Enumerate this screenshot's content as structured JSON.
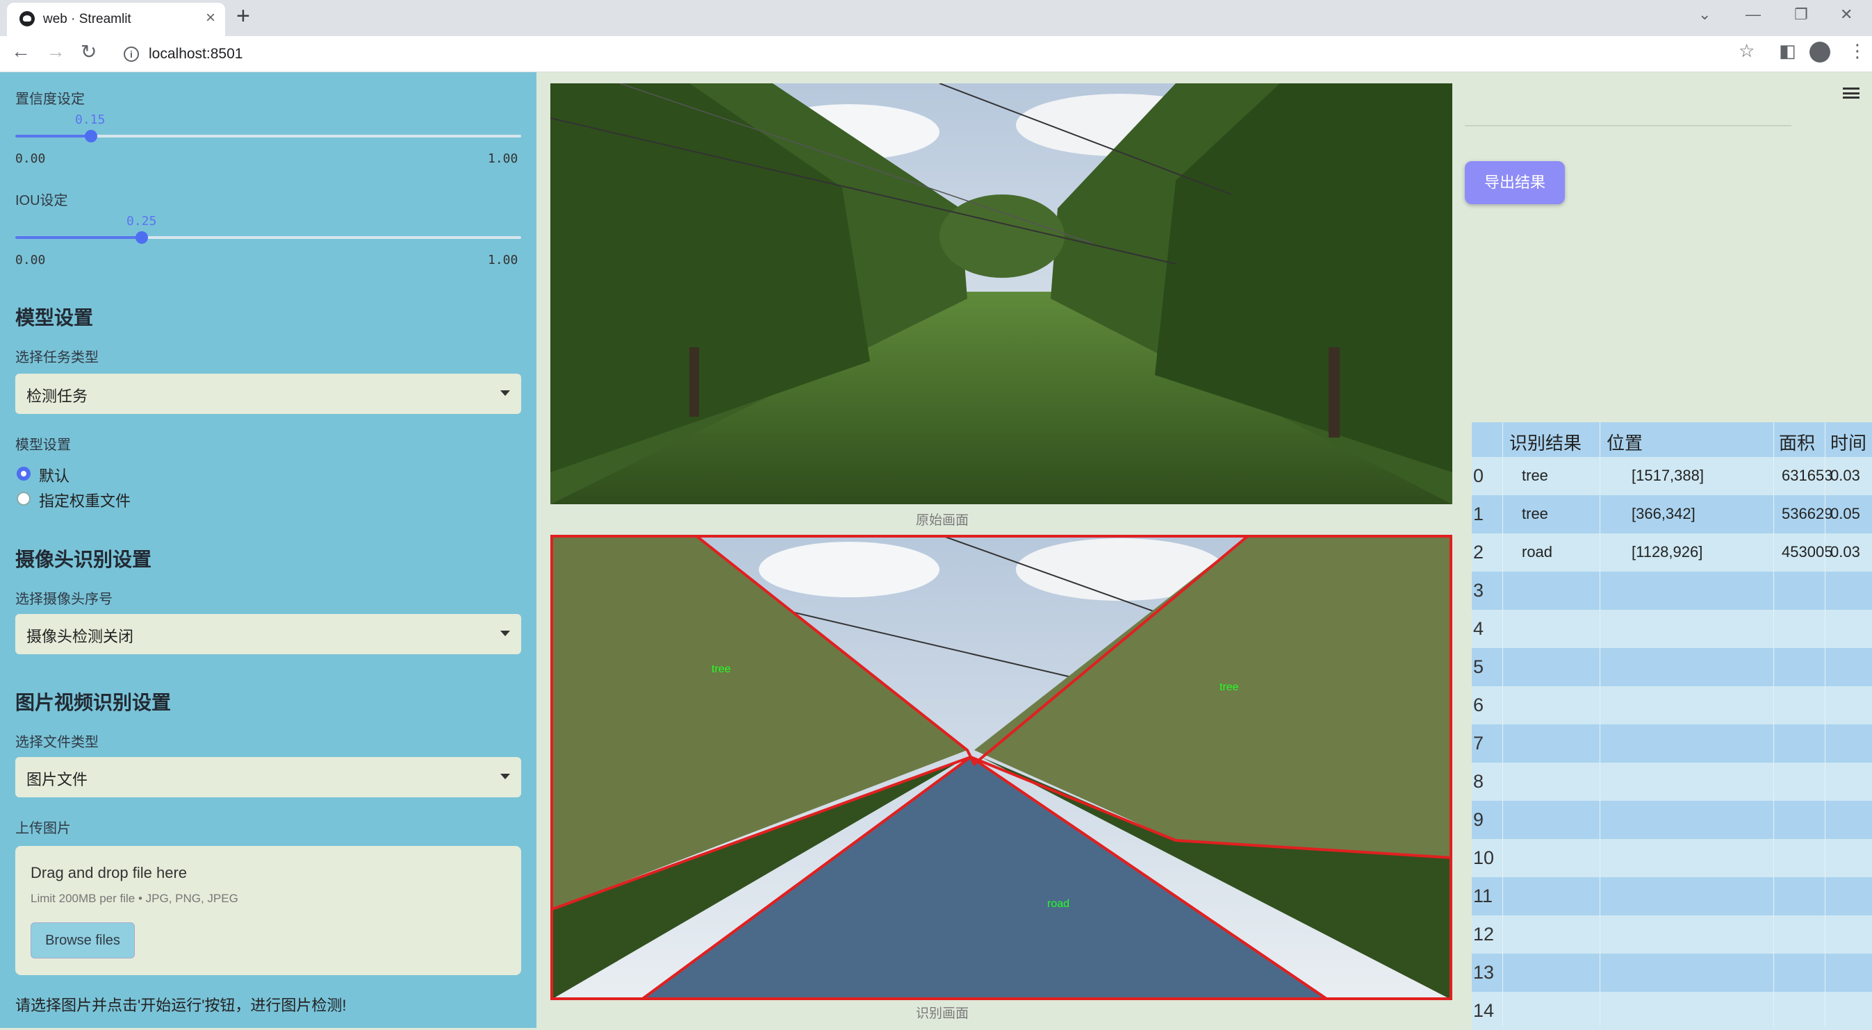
{
  "browser": {
    "tab_title": "web · Streamlit",
    "url": "localhost:8501"
  },
  "sidebar": {
    "confidence": {
      "label": "置信度设定",
      "value": "0.15",
      "min": "0.00",
      "max": "1.00",
      "fraction": 0.15
    },
    "iou": {
      "label": "IOU设定",
      "value": "0.25",
      "min": "0.00",
      "max": "1.00",
      "fraction": 0.25
    },
    "model_section": "模型设置",
    "task_label": "选择任务类型",
    "task_value": "检测任务",
    "model_label": "模型设置",
    "model_options": [
      "默认",
      "指定权重文件"
    ],
    "camera_section": "摄像头识别设置",
    "camera_label": "选择摄像头序号",
    "camera_value": "摄像头检测关闭",
    "media_section": "图片视频识别设置",
    "file_type_label": "选择文件类型",
    "file_type_value": "图片文件",
    "upload_label": "上传图片",
    "drop_text": "Drag and drop file here",
    "drop_limit": "Limit 200MB per file • JPG, PNG, JPEG",
    "browse_label": "Browse files",
    "hint": "请选择图片并点击'开始运行'按钮，进行图片检测!"
  },
  "main": {
    "original_caption": "原始画面",
    "detected_caption": "识别画面",
    "labels": [
      "tree",
      "tree",
      "road"
    ],
    "export_label": "导出结果"
  },
  "table": {
    "headers": [
      "识别结果",
      "位置",
      "面积",
      "时间"
    ],
    "rows": [
      {
        "idx": "0",
        "result": "tree",
        "pos": "[1517,388]",
        "area": "631653",
        "time": "0.03"
      },
      {
        "idx": "1",
        "result": "tree",
        "pos": "[366,342]",
        "area": "536629",
        "time": "0.05"
      },
      {
        "idx": "2",
        "result": "road",
        "pos": "[1128,926]",
        "area": "453005",
        "time": "0.03"
      },
      {
        "idx": "3"
      },
      {
        "idx": "4"
      },
      {
        "idx": "5"
      },
      {
        "idx": "6"
      },
      {
        "idx": "7"
      },
      {
        "idx": "8"
      },
      {
        "idx": "9"
      },
      {
        "idx": "10"
      },
      {
        "idx": "11"
      },
      {
        "idx": "12"
      },
      {
        "idx": "13"
      },
      {
        "idx": "14"
      }
    ]
  },
  "colors": {
    "sidebar": "#79c3d8",
    "accent": "#4d6ef0",
    "export_button": "#8e8cf6",
    "detect_box": "#e02020",
    "label_text": "#22ff22"
  }
}
